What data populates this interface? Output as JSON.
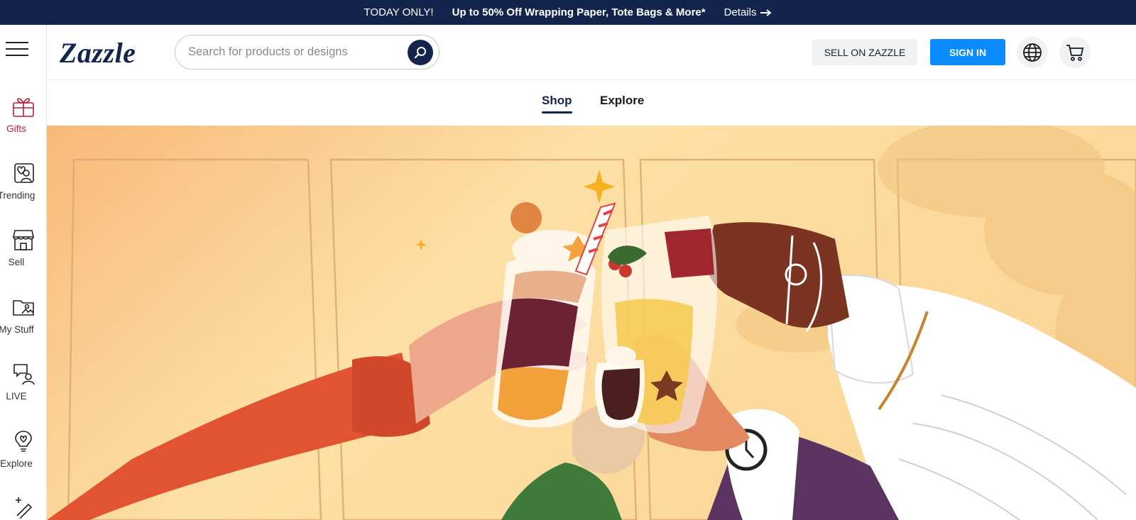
{
  "promo": {
    "today": "TODAY ONLY!",
    "offer": "Up to 50% Off Wrapping Paper, Tote Bags & More*",
    "details": "Details",
    "details_icon": "arrow-right-icon",
    "background": "#14254d"
  },
  "sidebar": {
    "menu_icon": "hamburger-menu-icon",
    "items": [
      {
        "label": "Gifts",
        "icon": "gift-icon",
        "active": true
      },
      {
        "label": "Trending",
        "icon": "trending-heart-icon"
      },
      {
        "label": "Sell",
        "icon": "storefront-icon"
      },
      {
        "label": "My Stuff",
        "icon": "folder-image-icon"
      },
      {
        "label": "LIVE",
        "icon": "chat-person-icon"
      },
      {
        "label": "Explore",
        "icon": "lightbulb-icon"
      }
    ],
    "active_color": "#b2223a"
  },
  "header": {
    "logo": "Zazzle",
    "search": {
      "placeholder": "Search for products or designs",
      "value": ""
    },
    "sell_label": "SELL ON ZAZZLE",
    "signin_label": "SIGN IN",
    "signin_color": "#0a8bff",
    "globe_icon": "globe-icon",
    "cart_icon": "cart-icon"
  },
  "tabs": [
    {
      "label": "Shop",
      "active": true
    },
    {
      "label": "Explore",
      "active": false
    }
  ],
  "hero": {
    "illustration": "holiday-drinks-toast-illustration",
    "background": "#fcd79a"
  }
}
